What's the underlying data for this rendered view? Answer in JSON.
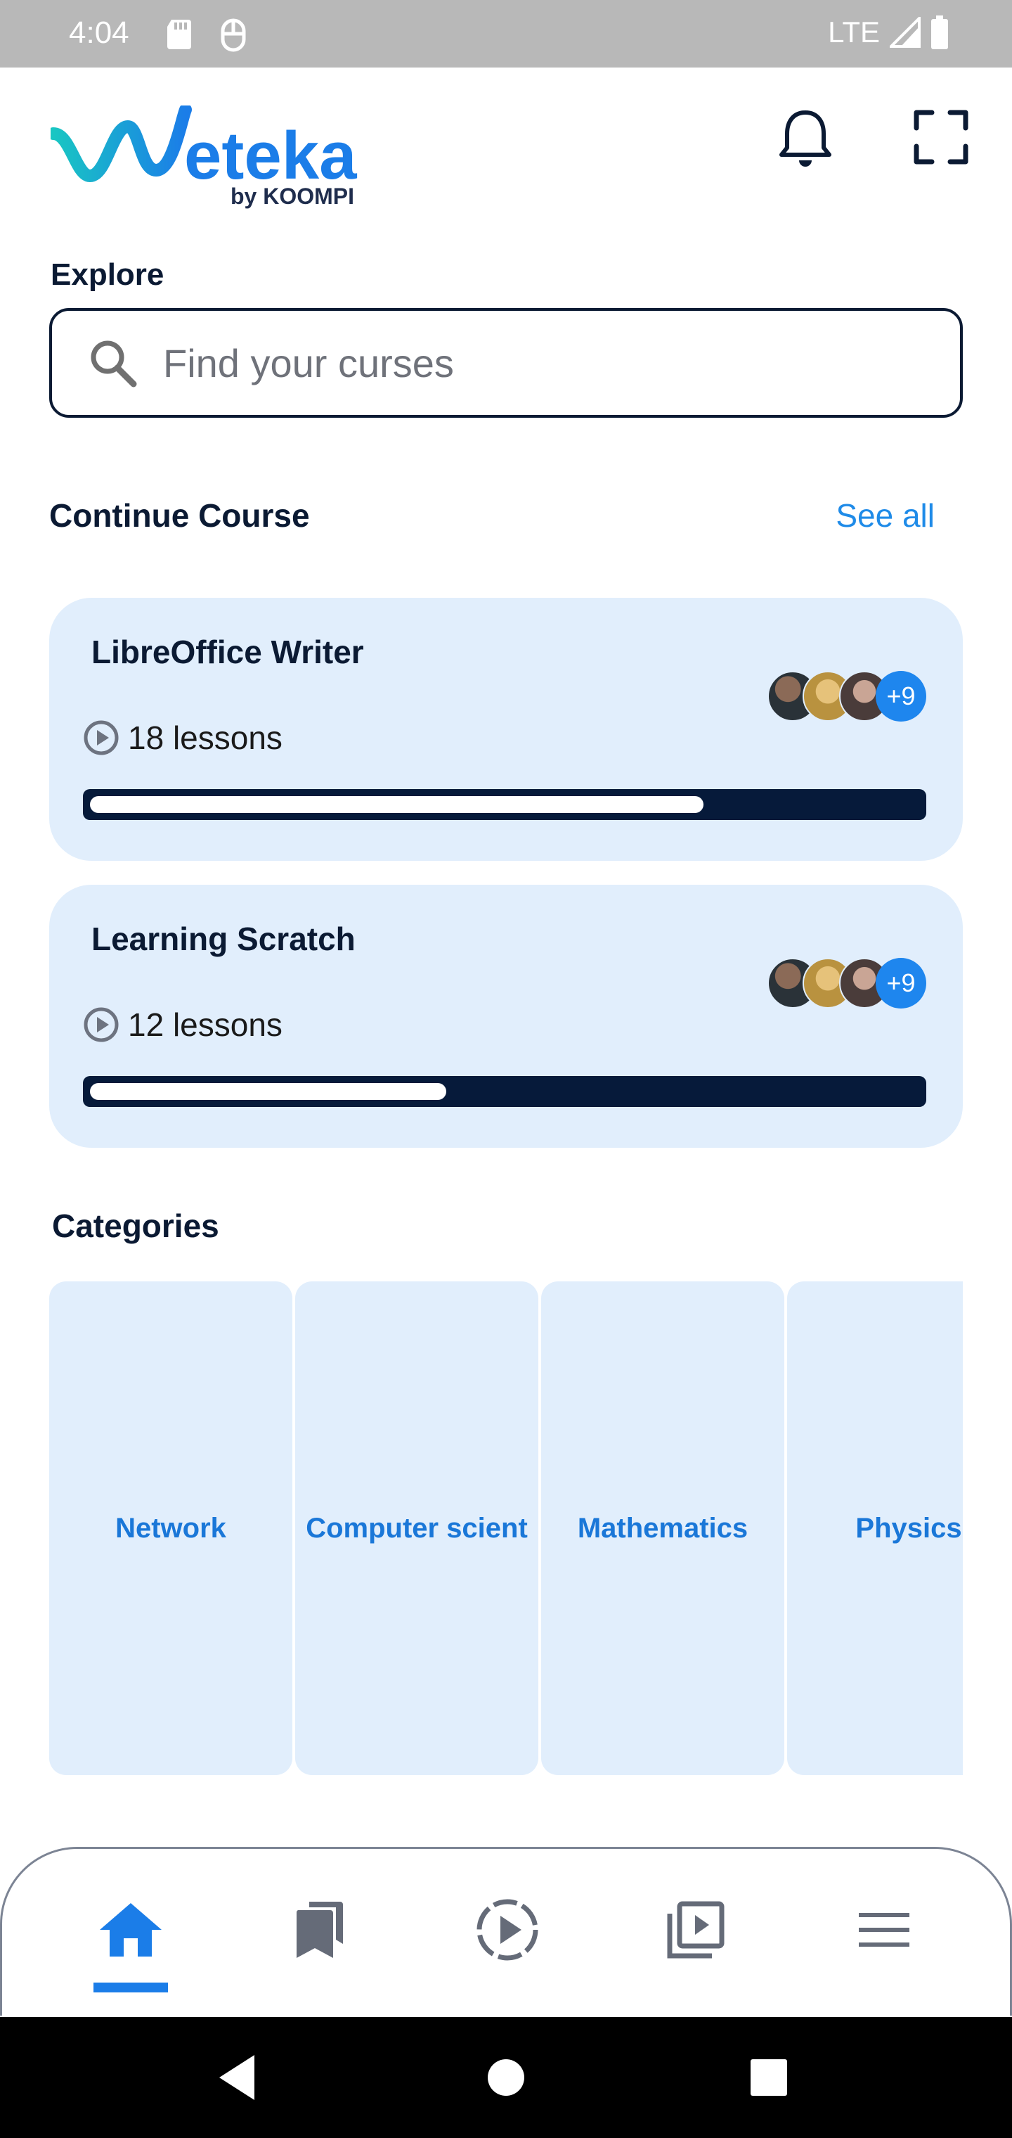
{
  "status_bar": {
    "time": "4:04",
    "network": "LTE"
  },
  "header": {
    "logo_text": "Weteka",
    "logo_subtext": "by KOOMPI"
  },
  "explore": {
    "label": "Explore",
    "search_placeholder": "Find your curses"
  },
  "continue_course": {
    "title": "Continue Course",
    "see_all": "See all",
    "courses": [
      {
        "title": "LibreOffice Writer",
        "lessons": "18 lessons",
        "progress": 0.74,
        "more_count": "+9"
      },
      {
        "title": "Learning Scratch",
        "lessons": "12 lessons",
        "progress": 0.43,
        "more_count": "+9"
      }
    ]
  },
  "categories": {
    "title": "Categories",
    "items": [
      {
        "label": "Network"
      },
      {
        "label": "Computer scient"
      },
      {
        "label": "Mathematics"
      },
      {
        "label": "Physics"
      }
    ]
  },
  "bottom_nav": {
    "items": [
      "home-icon",
      "bookmarks-icon",
      "play-circle-icon",
      "video-library-icon",
      "menu-icon"
    ],
    "active_index": 0
  },
  "colors": {
    "accent": "#1b7de8",
    "navy": "#061a3a",
    "card_bg": "#e1eefc",
    "logo_teal": "#1cc2c7"
  }
}
